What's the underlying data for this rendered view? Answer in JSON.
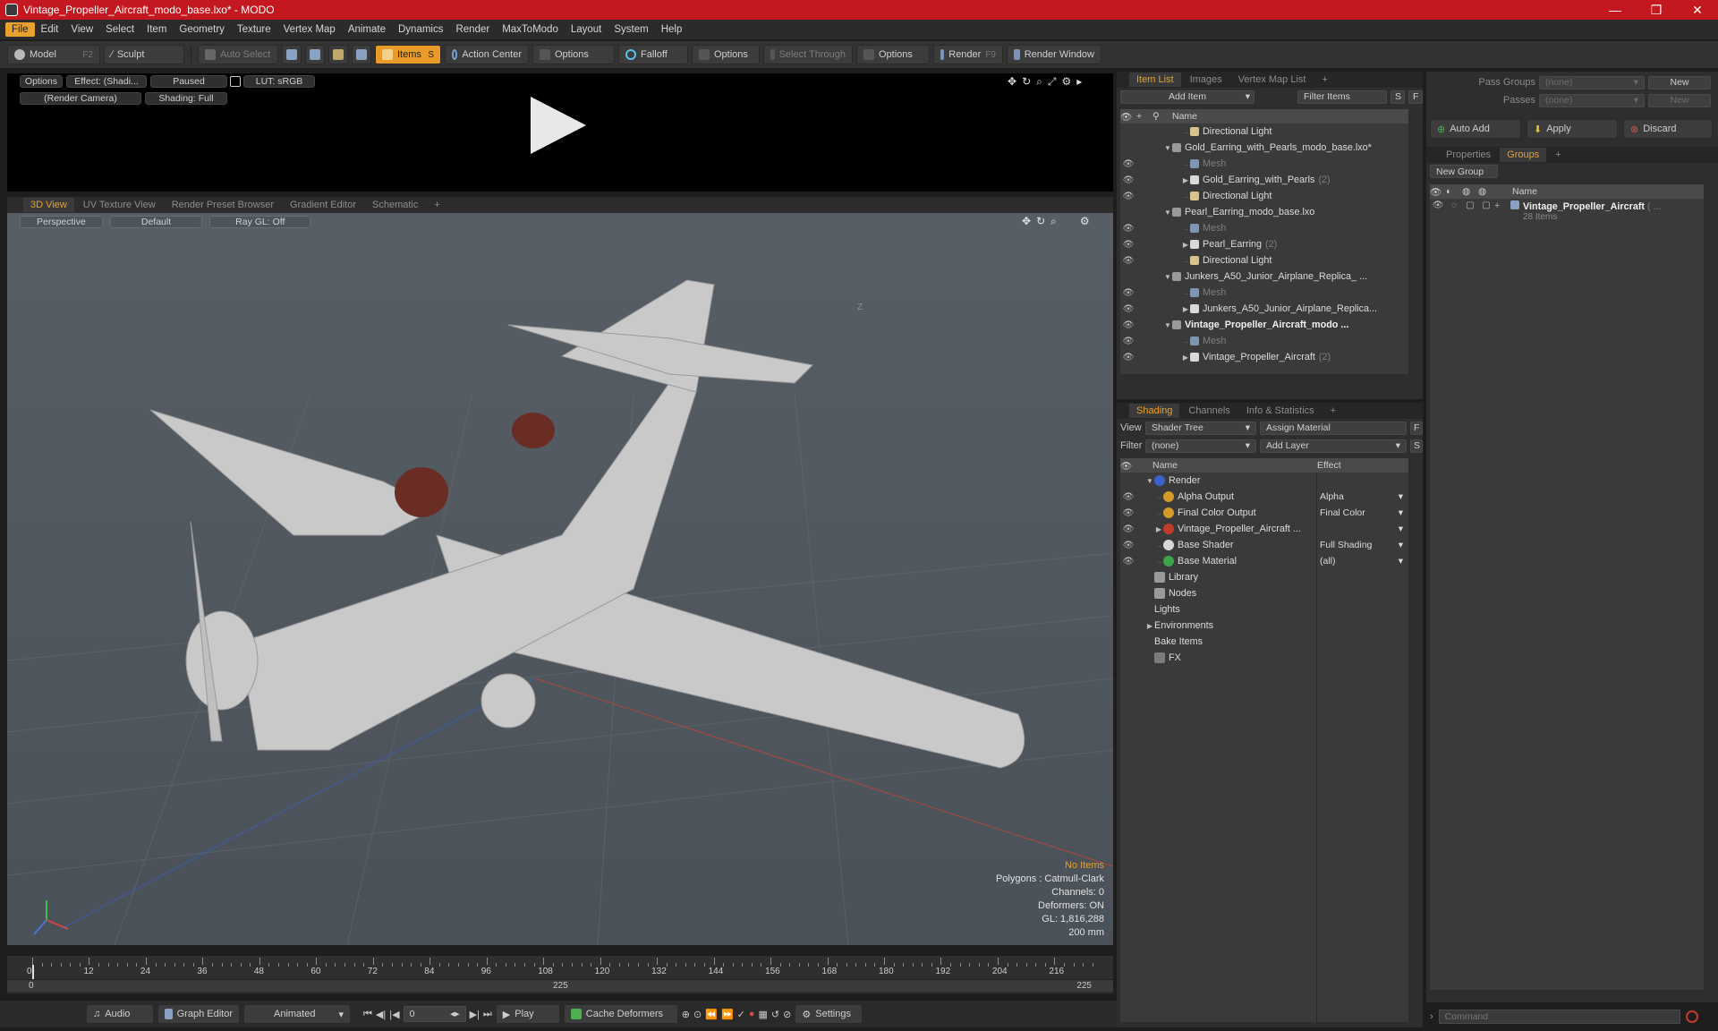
{
  "title": "Vintage_Propeller_Aircraft_modo_base.lxo* - MODO",
  "window": {
    "minimize": "—",
    "restore": "❐",
    "close": "✕"
  },
  "menu": [
    "File",
    "Edit",
    "View",
    "Select",
    "Item",
    "Geometry",
    "Texture",
    "Vertex Map",
    "Animate",
    "Dynamics",
    "Render",
    "MaxToModo",
    "Layout",
    "System",
    "Help"
  ],
  "toolbar": {
    "model": "Model",
    "model_key": "F2",
    "sculpt": "Sculpt",
    "auto_select": "Auto Select",
    "items": "Items",
    "items_key": "S",
    "action_center": "Action Center",
    "options1": "Options",
    "falloff": "Falloff",
    "options2": "Options",
    "select_through": "Select Through",
    "options3": "Options",
    "render": "Render",
    "render_key": "F9",
    "render_window": "Render Window"
  },
  "preview": {
    "options": "Options",
    "effect": "Effect: (Shadi...",
    "paused": "Paused",
    "lut": "LUT: sRGB",
    "camera": "(Render Camera)",
    "shading": "Shading: Full"
  },
  "view_tabs": [
    "3D View",
    "UV Texture View",
    "Render Preset Browser",
    "Gradient Editor",
    "Schematic",
    "+"
  ],
  "viewport": {
    "perspective": "Perspective",
    "default": "Default",
    "raygl": "Ray GL: Off",
    "axis_label": "Z",
    "hud": {
      "no_items": "No Items",
      "polygons": "Polygons : Catmull-Clark",
      "channels": "Channels: 0",
      "deformers": "Deformers: ON",
      "gl": "GL: 1,816,288",
      "scale": "200 mm"
    }
  },
  "timeline": {
    "ticks": [
      "0",
      "12",
      "24",
      "36",
      "48",
      "60",
      "72",
      "84",
      "96",
      "108",
      "120",
      "132",
      "144",
      "156",
      "168",
      "180",
      "192",
      "204",
      "216"
    ],
    "start": "0",
    "mid": "225",
    "end": "225"
  },
  "bottom": {
    "audio": "Audio",
    "graph_editor": "Graph Editor",
    "animated": "Animated",
    "frame": "0",
    "play": "Play",
    "cache_deformers": "Cache Deformers",
    "settings": "Settings"
  },
  "item_list": {
    "tabs": [
      "Item List",
      "Images",
      "Vertex Map List",
      "+"
    ],
    "add_item": "Add Item",
    "filter_items": "Filter Items",
    "s": "S",
    "f": "F",
    "name_col": "Name",
    "rows": [
      {
        "label": "Directional Light",
        "indent": 5,
        "type": "light",
        "arrow": "",
        "eye": false,
        "muted": false,
        "bold": false,
        "count": ""
      },
      {
        "label": "Gold_Earring_with_Pearls_modo_base.lxo*",
        "indent": 3,
        "type": "scene",
        "arrow": "▼",
        "eye": false,
        "muted": false,
        "bold": false,
        "count": ""
      },
      {
        "label": "Mesh",
        "indent": 5,
        "type": "mesh",
        "arrow": "",
        "eye": true,
        "muted": true,
        "bold": false,
        "count": ""
      },
      {
        "label": "Gold_Earring_with_Pearls",
        "indent": 5,
        "type": "group",
        "arrow": "▶",
        "eye": true,
        "muted": false,
        "bold": false,
        "count": "(2)"
      },
      {
        "label": "Directional Light",
        "indent": 5,
        "type": "light",
        "arrow": "",
        "eye": true,
        "muted": false,
        "bold": false,
        "count": ""
      },
      {
        "label": "Pearl_Earring_modo_base.lxo",
        "indent": 3,
        "type": "scene",
        "arrow": "▼",
        "eye": false,
        "muted": false,
        "bold": false,
        "count": ""
      },
      {
        "label": "Mesh",
        "indent": 5,
        "type": "mesh",
        "arrow": "",
        "eye": true,
        "muted": true,
        "bold": false,
        "count": ""
      },
      {
        "label": "Pearl_Earring",
        "indent": 5,
        "type": "group",
        "arrow": "▶",
        "eye": true,
        "muted": false,
        "bold": false,
        "count": "(2)"
      },
      {
        "label": "Directional Light",
        "indent": 5,
        "type": "light",
        "arrow": "",
        "eye": true,
        "muted": false,
        "bold": false,
        "count": ""
      },
      {
        "label": "Junkers_A50_Junior_Airplane_Replica_ ...",
        "indent": 3,
        "type": "scene",
        "arrow": "▼",
        "eye": false,
        "muted": false,
        "bold": false,
        "count": ""
      },
      {
        "label": "Mesh",
        "indent": 5,
        "type": "mesh",
        "arrow": "",
        "eye": true,
        "muted": true,
        "bold": false,
        "count": ""
      },
      {
        "label": "Junkers_A50_Junior_Airplane_Replica...",
        "indent": 5,
        "type": "group",
        "arrow": "▶",
        "eye": true,
        "muted": false,
        "bold": false,
        "count": ""
      },
      {
        "label": "Vintage_Propeller_Aircraft_modo ...",
        "indent": 3,
        "type": "scene",
        "arrow": "▼",
        "eye": true,
        "muted": false,
        "bold": true,
        "count": ""
      },
      {
        "label": "Mesh",
        "indent": 5,
        "type": "mesh",
        "arrow": "",
        "eye": true,
        "muted": true,
        "bold": false,
        "count": ""
      },
      {
        "label": "Vintage_Propeller_Aircraft",
        "indent": 5,
        "type": "group",
        "arrow": "▶",
        "eye": true,
        "muted": false,
        "bold": false,
        "count": "(2)"
      }
    ]
  },
  "shading": {
    "tabs": [
      "Shading",
      "Channels",
      "Info & Statistics",
      "+"
    ],
    "view_label": "View",
    "view_value": "Shader Tree",
    "assign_material": "Assign Material",
    "f": "F",
    "filter_label": "Filter",
    "filter_value": "(none)",
    "add_layer": "Add Layer",
    "s": "S",
    "name_col": "Name",
    "effect_col": "Effect",
    "rows": [
      {
        "label": "Render",
        "indent": 1,
        "arrow": "▼",
        "icon": "#3a62c9",
        "eye": false,
        "effect": ""
      },
      {
        "label": "Alpha Output",
        "indent": 2,
        "arrow": "",
        "icon": "#d49a2a",
        "eye": true,
        "effect": "Alpha"
      },
      {
        "label": "Final Color Output",
        "indent": 2,
        "arrow": "",
        "icon": "#d49a2a",
        "eye": true,
        "effect": "Final Color"
      },
      {
        "label": "Vintage_Propeller_Aircraft ...",
        "indent": 2,
        "arrow": "▶",
        "icon": "#c23a2a",
        "eye": true,
        "effect": ""
      },
      {
        "label": "Base Shader",
        "indent": 2,
        "arrow": "",
        "icon": "#d8d8d8",
        "eye": true,
        "effect": "Full Shading"
      },
      {
        "label": "Base Material",
        "indent": 2,
        "arrow": "",
        "icon": "#3fa54a",
        "eye": true,
        "effect": "(all)"
      },
      {
        "label": "Library",
        "indent": 1,
        "arrow": "",
        "icon": "folder",
        "eye": false,
        "effect": ""
      },
      {
        "label": "Nodes",
        "indent": 1,
        "arrow": "",
        "icon": "folder",
        "eye": false,
        "effect": ""
      },
      {
        "label": "Lights",
        "indent": 1,
        "arrow": "",
        "icon": "",
        "eye": false,
        "effect": ""
      },
      {
        "label": "Environments",
        "indent": 1,
        "arrow": "▶",
        "icon": "",
        "eye": false,
        "effect": ""
      },
      {
        "label": "Bake Items",
        "indent": 1,
        "arrow": "",
        "icon": "",
        "eye": false,
        "effect": ""
      },
      {
        "label": "FX",
        "indent": 1,
        "arrow": "",
        "icon": "fx",
        "eye": false,
        "effect": ""
      }
    ]
  },
  "groups": {
    "pass_groups_label": "Pass Groups",
    "pass_groups_value": "(none)",
    "new": "New",
    "passes_label": "Passes",
    "passes_value": "(none)",
    "new2": "New",
    "auto_add": "Auto Add",
    "apply": "Apply",
    "discard": "Discard",
    "tabs": [
      "Properties",
      "Groups",
      "+"
    ],
    "new_group": "New Group",
    "name_col": "Name",
    "group_name": "Vintage_Propeller_Aircraft",
    "group_suffix": "( ...",
    "group_count": "28 Items"
  },
  "command": {
    "placeholder": "Command"
  }
}
